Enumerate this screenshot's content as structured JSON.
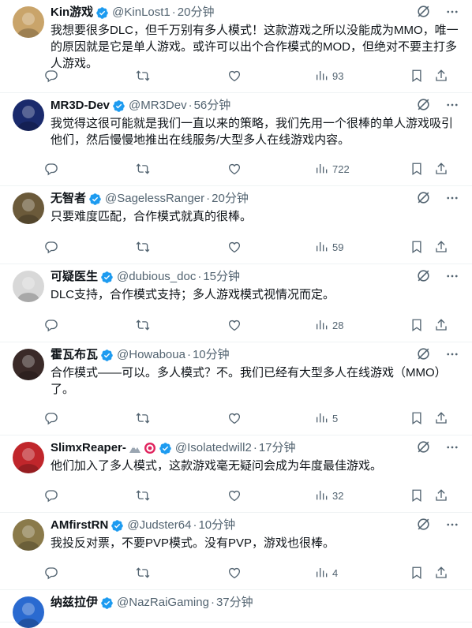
{
  "tweets": [
    {
      "name": "Kin游戏",
      "handle": "@KinLost1",
      "time": "20分钟",
      "text": "我想要很多DLC，但千万别有多人模式！这款游戏之所以没能成为MMO，唯一的原因就是它是单人游戏。或许可以出个合作模式的MOD，但绝对不要主打多人游戏。",
      "views": "93",
      "avatar_color": "#c9a46a"
    },
    {
      "name": "MR3D-Dev",
      "handle": "@MR3Dev",
      "time": "56分钟",
      "text": "我觉得这很可能就是我们一直以来的策略，我们先用一个很棒的单人游戏吸引他们，然后慢慢地推出在线服务/大型多人在线游戏内容。",
      "views": "722",
      "avatar_color": "#1a2a6c"
    },
    {
      "name": "无智者",
      "handle": "@SagelessRanger",
      "time": "20分钟",
      "text": "只要难度匹配，合作模式就真的很棒。",
      "views": "59",
      "avatar_color": "#6b5a3a"
    },
    {
      "name": "可疑医生",
      "handle": "@dubious_doc",
      "time": "15分钟",
      "text": "DLC支持，合作模式支持；多人游戏模式视情况而定。",
      "views": "28",
      "avatar_color": "#d8d8d8"
    },
    {
      "name": "霍瓦布瓦",
      "handle": "@Howaboua",
      "time": "10分钟",
      "text": "合作模式——可以。多人模式？不。我们已经有大型多人在线游戏（MMO）了。",
      "views": "5",
      "avatar_color": "#3a2a28"
    },
    {
      "name": "SlimxReaper-",
      "handle": "@Isolatedwill2",
      "time": "17分钟",
      "text": "他们加入了多人模式，这款游戏毫无疑问会成为年度最佳游戏。",
      "views": "32",
      "avatar_color": "#c0262b"
    },
    {
      "name": "AMfirstRN",
      "handle": "@Judster64",
      "time": "10分钟",
      "text": "我投反对票，不要PVP模式。没有PVP，游戏也很棒。",
      "views": "4",
      "avatar_color": "#8a7a4a"
    },
    {
      "name": "纳兹拉伊",
      "handle": "@NazRaiGaming",
      "time": "37分钟",
      "text": "",
      "views": "",
      "avatar_color": "#2a6ad0"
    }
  ],
  "colors": {
    "verified": "#1d9bf0",
    "muted": "#536471"
  },
  "icons": [
    "reply-icon",
    "retweet-icon",
    "like-icon",
    "views-icon",
    "bookmark-icon",
    "share-icon",
    "grok-icon",
    "more-icon",
    "verified-badge-icon"
  ]
}
